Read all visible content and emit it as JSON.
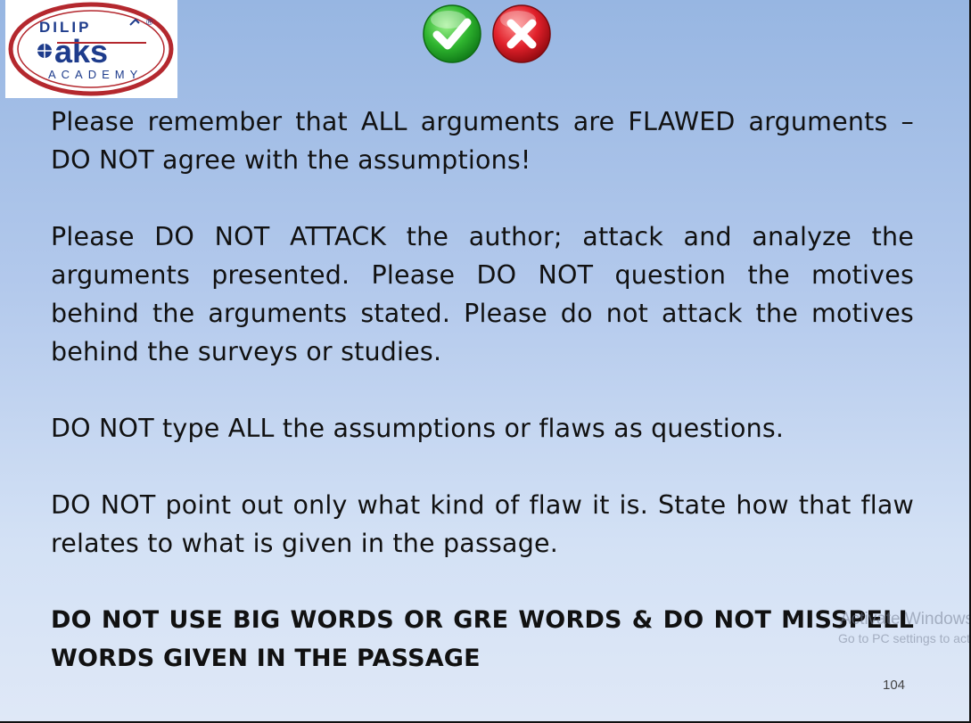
{
  "logo": {
    "top_text": "DILIP",
    "brand": "aks",
    "bottom_text": "ACADEMY",
    "registered_mark": "®",
    "colors": {
      "ring": "#b4282e",
      "brand": "#1e3c8c",
      "accent": "#b4282e"
    }
  },
  "toolbar": {
    "check_icon": "check-icon",
    "cross_icon": "close-icon",
    "check_color": "#2fb52f",
    "cross_color": "#e0202a"
  },
  "content": {
    "paragraphs": [
      "Please remember that ALL arguments are FLAWED arguments – DO NOT agree with the assumptions!",
      "Please DO NOT ATTACK the author; attack and analyze the arguments presented. Please DO NOT question the motives behind the arguments stated. Please do not attack the motives behind the surveys or studies.",
      "DO NOT type ALL the assumptions or flaws as questions.",
      "DO NOT point out only what kind of flaw it is. State how that flaw relates to what is given in the passage."
    ],
    "bold_paragraph": "DO NOT USE BIG WORDS OR GRE WORDS & DO NOT MISSPELL WORDS GIVEN IN THE PASSAGE"
  },
  "page_number": "104",
  "watermark": {
    "line1": "Activate Windows",
    "line2": "Go to PC settings to activate Windows."
  }
}
